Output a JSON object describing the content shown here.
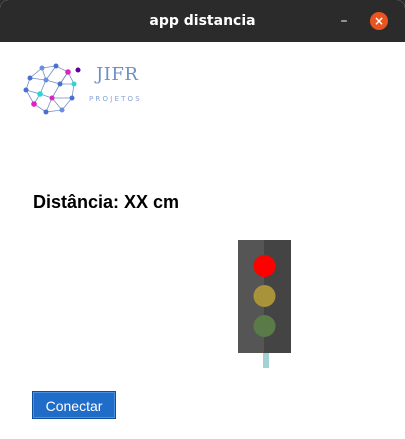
{
  "window": {
    "title": "app distancia",
    "minimize_label": "–",
    "close_label": "×"
  },
  "logo": {
    "name": "JIFR",
    "subtitle": "PROJETOS"
  },
  "distance_label": "Distância: XX cm",
  "traffic_light": {
    "red": "#ff0000",
    "yellow": "#a8923a",
    "green": "#5a7a48",
    "housing": "#555555"
  },
  "connect_button": "Conectar",
  "colors": {
    "titlebar": "#2b2b2b",
    "close_button": "#e95420",
    "button_blue": "#1f6dc9"
  }
}
